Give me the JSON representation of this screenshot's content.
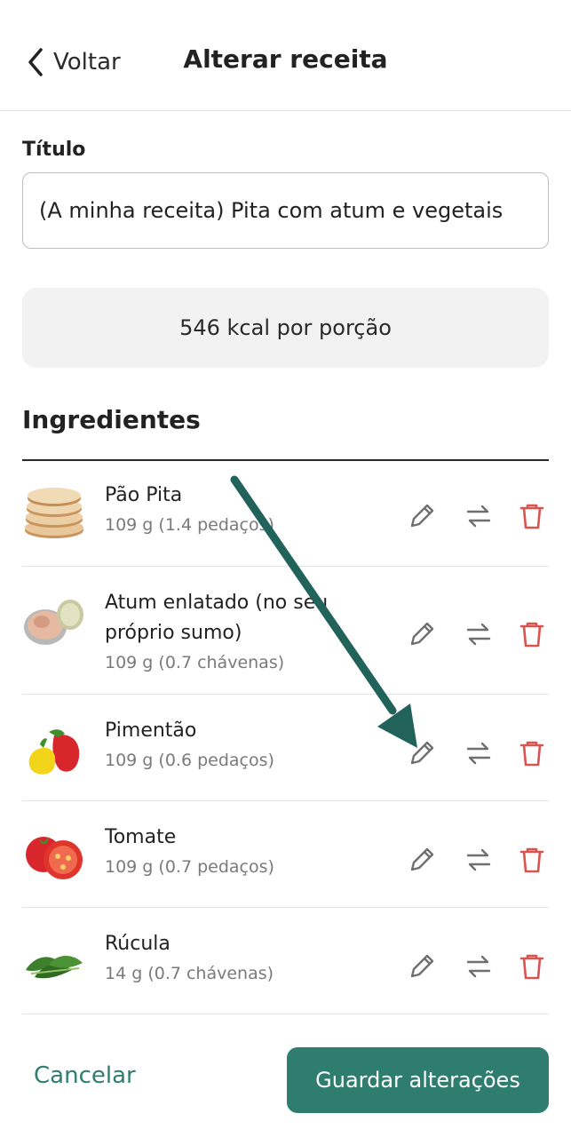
{
  "header": {
    "back_label": "Voltar",
    "title": "Alterar receita"
  },
  "form": {
    "title_label": "Título",
    "title_value": "(A minha receita) Pita com atum e vegetais",
    "kcal_text": "546 kcal por porção"
  },
  "ingredients": {
    "section_title": "Ingredientes",
    "items": [
      {
        "name": "Pão Pita",
        "quantity": "109 g (1.4 pedaços)",
        "image": "pita-bread-image"
      },
      {
        "name": "Atum enlatado (no seu próprio sumo)",
        "quantity": "109 g (0.7 chávenas)",
        "image": "canned-tuna-image"
      },
      {
        "name": "Pimentão",
        "quantity": "109 g (0.6 pedaços)",
        "image": "bell-pepper-image"
      },
      {
        "name": "Tomate",
        "quantity": "109 g (0.7 pedaços)",
        "image": "tomato-image"
      },
      {
        "name": "Rúcula",
        "quantity": "14 g (0.7 chávenas)",
        "image": "arugula-image"
      }
    ]
  },
  "footer": {
    "cancel_label": "Cancelar",
    "save_label": "Guardar alterações"
  },
  "colors": {
    "accent": "#2e7d6e",
    "delete": "#d9534f",
    "annotation_arrow": "#21625a"
  }
}
